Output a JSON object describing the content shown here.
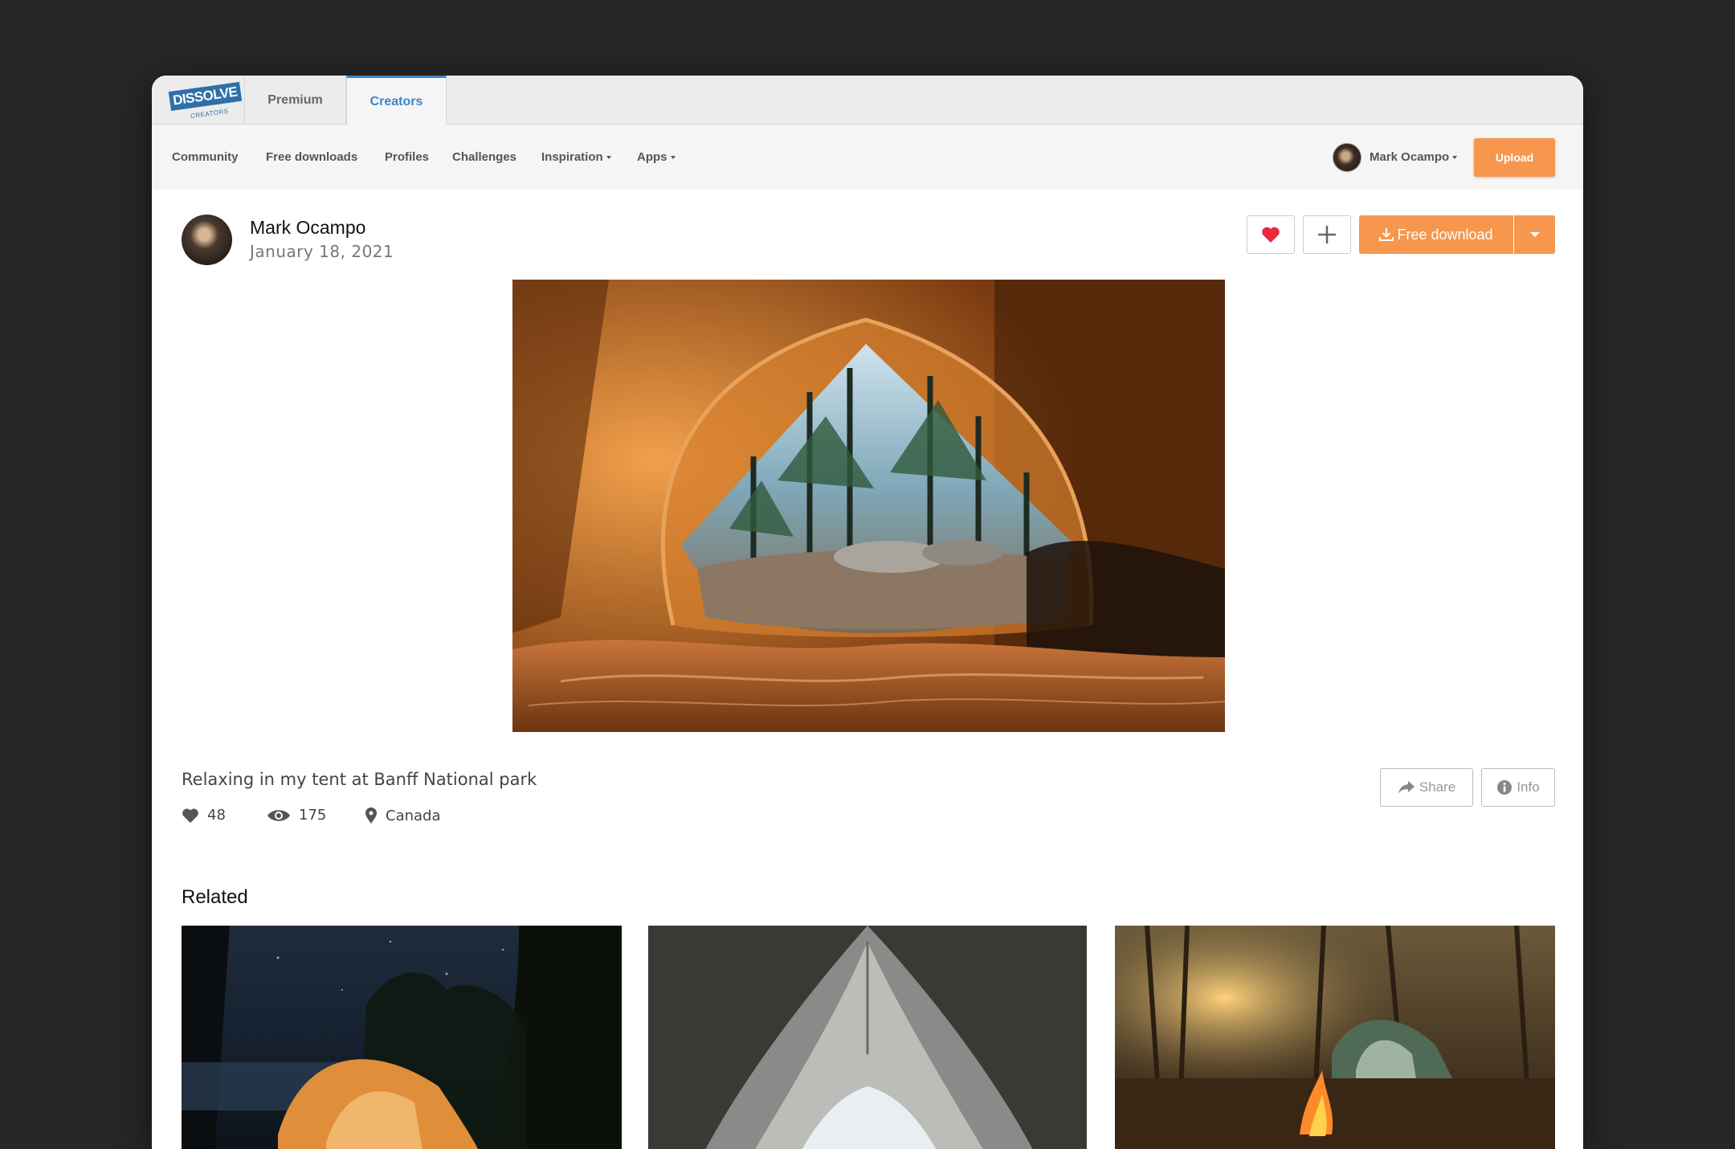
{
  "tabs": {
    "logo_text": "DISSOLVE",
    "logo_sub": "CREATORS",
    "premium": "Premium",
    "creators": "Creators"
  },
  "nav": {
    "community": "Community",
    "free_downloads": "Free downloads",
    "profiles": "Profiles",
    "challenges": "Challenges",
    "inspiration": "Inspiration",
    "apps": "Apps",
    "user_name": "Mark Ocampo",
    "upload": "Upload"
  },
  "photo": {
    "author": "Mark Ocampo",
    "date": "January 18, 2021",
    "download_label": "Free download",
    "caption": "Relaxing in my tent at Banff National park",
    "likes": "48",
    "views": "175",
    "location": "Canada",
    "share_label": "Share",
    "info_label": "Info"
  },
  "related": {
    "title": "Related"
  },
  "colors": {
    "accent_orange": "#f7964d",
    "link_blue": "#3b86c8",
    "heart_red": "#e8283c"
  }
}
